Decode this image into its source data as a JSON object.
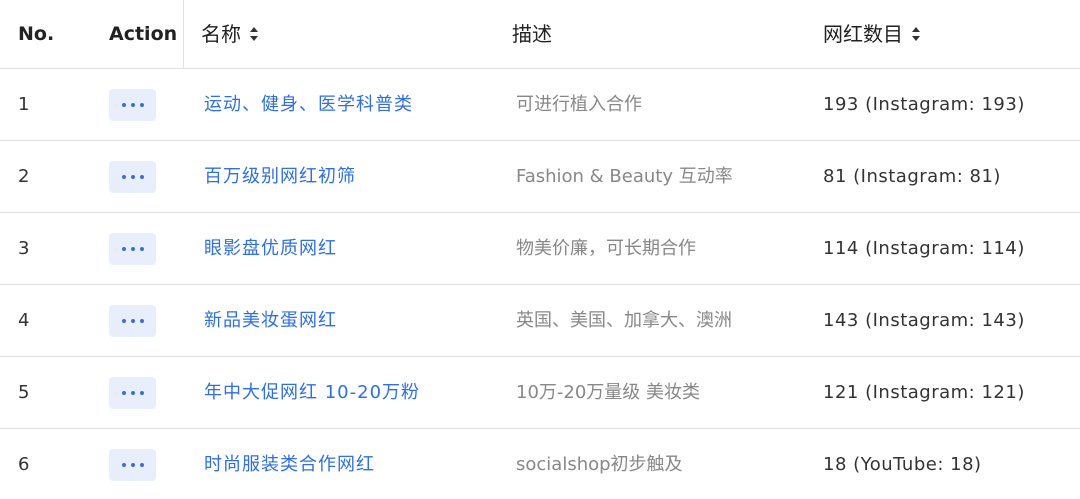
{
  "header": {
    "no": "No.",
    "action": "Action",
    "name": "名称",
    "description": "描述",
    "influencer_count": "网红数目"
  },
  "rows": [
    {
      "no": "1",
      "name": "运动、健身、医学科普类",
      "description": "可进行植入合作",
      "count": "193 (Instagram: 193)"
    },
    {
      "no": "2",
      "name": "百万级别网红初筛",
      "description": "Fashion & Beauty 互动率",
      "count": "81 (Instagram: 81)"
    },
    {
      "no": "3",
      "name": "眼影盘优质网红",
      "description": "物美价廉，可长期合作",
      "count": "114 (Instagram: 114)"
    },
    {
      "no": "4",
      "name": "新品美妆蛋网红",
      "description": "英国、美国、加拿大、澳洲",
      "count": "143 (Instagram: 143)"
    },
    {
      "no": "5",
      "name": "年中大促网红 10-20万粉",
      "description": "10万-20万量级 美妆类",
      "count": "121 (Instagram: 121)"
    },
    {
      "no": "6",
      "name": "时尚服装类合作网红",
      "description": "socialshop初步触及",
      "count": "18 (YouTube: 18)"
    }
  ],
  "colors": {
    "link": "#2f6fe0",
    "action_bg": "#e8eefb",
    "muted_text": "#888888",
    "divider": "#e2e2e2"
  }
}
